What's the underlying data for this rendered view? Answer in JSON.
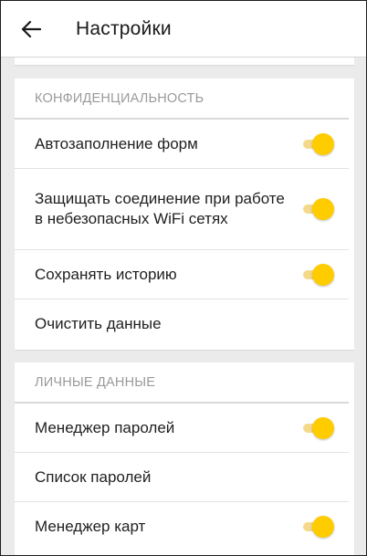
{
  "header": {
    "title": "Настройки",
    "back_icon": "arrow-left-icon"
  },
  "colors": {
    "accent": "#ffcc00",
    "accent_track": "#f4d98a",
    "background": "#ebebeb",
    "section_header_text": "#9a9a9a"
  },
  "privacy": {
    "header": "КОНФИДЕНЦИАЛЬНОСТЬ",
    "items": [
      {
        "label": "Автозаполнение форм",
        "toggle": true
      },
      {
        "label": "Защищать соединение при работе в небезопасных WiFi сетях",
        "toggle": true
      },
      {
        "label": "Сохранять историю",
        "toggle": true
      },
      {
        "label": "Очистить данные"
      }
    ]
  },
  "personal": {
    "header": "ЛИЧНЫЕ ДАННЫЕ",
    "items": [
      {
        "label": "Менеджер паролей",
        "toggle": true
      },
      {
        "label": "Список паролей"
      },
      {
        "label": "Менеджер карт",
        "toggle": true
      }
    ]
  }
}
